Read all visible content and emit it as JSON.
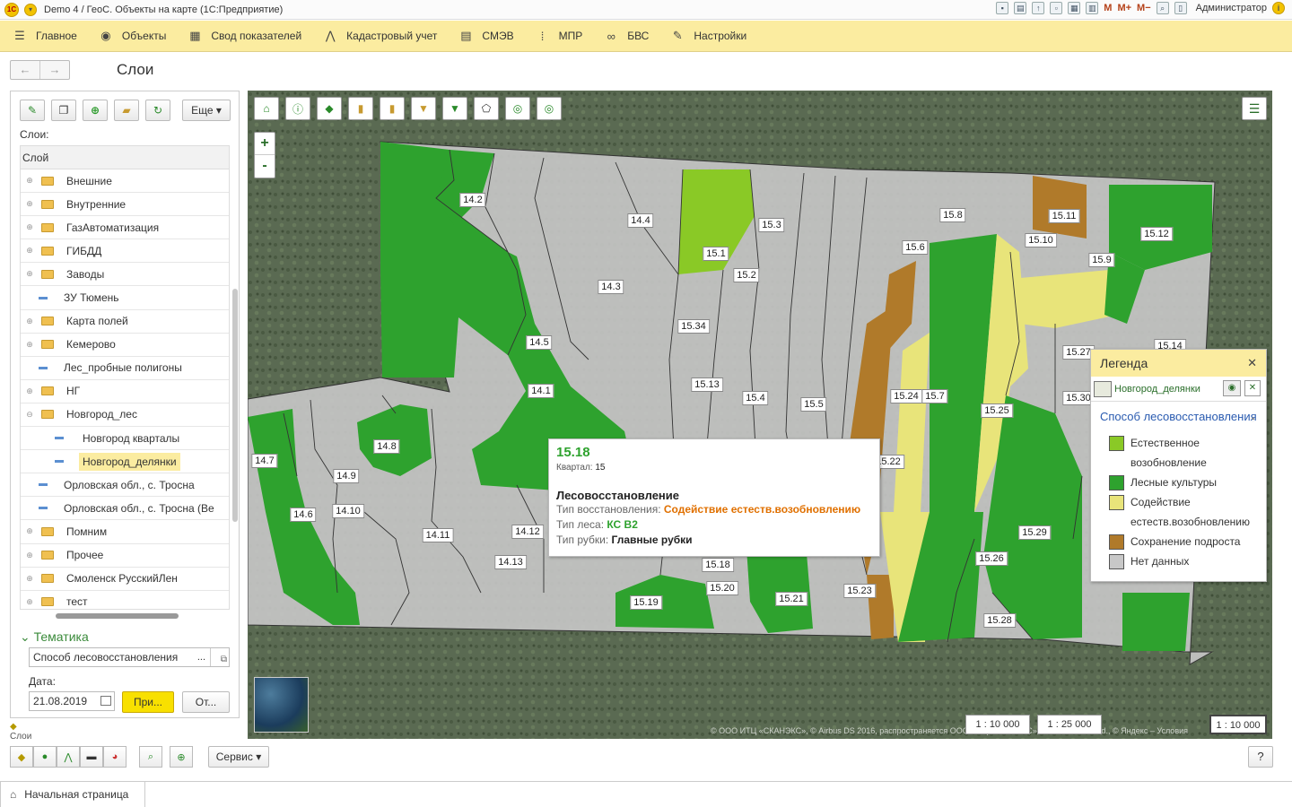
{
  "window": {
    "title": "Demo 4 / ГеоС. Объекты на карте",
    "app": "(1С:Предприятие)",
    "user": "Администратор"
  },
  "sections": [
    {
      "label": "Главное",
      "icon": "hamburger-icon"
    },
    {
      "label": "Объекты",
      "icon": "globe-icon"
    },
    {
      "label": "Свод показателей",
      "icon": "table-icon"
    },
    {
      "label": "Кадастровый учет",
      "icon": "compass-icon"
    },
    {
      "label": "СМЭВ",
      "icon": "document-icon"
    },
    {
      "label": "МПР",
      "icon": "blocks-icon"
    },
    {
      "label": "БВС",
      "icon": "link-icon"
    },
    {
      "label": "Настройки",
      "icon": "wrench-icon"
    }
  ],
  "page": {
    "title": "Слои"
  },
  "left": {
    "more_label": "Еще",
    "layers_label": "Слои:",
    "tree_header": "Слой",
    "tree": [
      {
        "label": "Внешние",
        "type": "folder"
      },
      {
        "label": "Внутренние",
        "type": "folder"
      },
      {
        "label": "ГазАвтоматизация",
        "type": "folder"
      },
      {
        "label": "ГИБДД",
        "type": "folder"
      },
      {
        "label": "Заводы",
        "type": "folder"
      },
      {
        "label": "ЗУ Тюмень",
        "type": "layer"
      },
      {
        "label": "Карта полей",
        "type": "folder"
      },
      {
        "label": "Кемерово",
        "type": "folder"
      },
      {
        "label": "Лес_пробные полигоны",
        "type": "layer"
      },
      {
        "label": "НГ",
        "type": "folder"
      },
      {
        "label": "Новгород_лес",
        "type": "folder-open"
      },
      {
        "label": "Новгород кварталы",
        "type": "child"
      },
      {
        "label": "Новгород_делянки",
        "type": "child-selected"
      },
      {
        "label": "Орловская обл., с. Тросна",
        "type": "layer"
      },
      {
        "label": "Орловская обл., с. Тросна (Ве",
        "type": "layer"
      },
      {
        "label": "Помним",
        "type": "folder"
      },
      {
        "label": "Прочее",
        "type": "folder"
      },
      {
        "label": "Смоленск РусскийЛен",
        "type": "folder"
      },
      {
        "label": "тест",
        "type": "folder"
      }
    ],
    "theme_header": "Тематика",
    "theme_value": "Способ лесовосстановления",
    "date_label": "Дата:",
    "date_value": "21.08.2019",
    "apply_label": "При...",
    "cancel_label": "От...",
    "bottom_label": "Слои"
  },
  "map": {
    "plots": [
      {
        "id": "14.2"
      },
      {
        "id": "14.4"
      },
      {
        "id": "15.1"
      },
      {
        "id": "15.3"
      },
      {
        "id": "15.2"
      },
      {
        "id": "14.3"
      },
      {
        "id": "15.34"
      },
      {
        "id": "14.5"
      },
      {
        "id": "15.13"
      },
      {
        "id": "14.1"
      },
      {
        "id": "15.4"
      },
      {
        "id": "15.5"
      },
      {
        "id": "15.8"
      },
      {
        "id": "15.6"
      },
      {
        "id": "15.11"
      },
      {
        "id": "15.10"
      },
      {
        "id": "15.12"
      },
      {
        "id": "15.9"
      },
      {
        "id": "15.27"
      },
      {
        "id": "15.14"
      },
      {
        "id": "15.24"
      },
      {
        "id": "15.7"
      },
      {
        "id": "15.25"
      },
      {
        "id": "15.30"
      },
      {
        "id": "15.22"
      },
      {
        "id": "14.8"
      },
      {
        "id": "14.7"
      },
      {
        "id": "14.9"
      },
      {
        "id": "14.6"
      },
      {
        "id": "14.10"
      },
      {
        "id": "14.11"
      },
      {
        "id": "14.12"
      },
      {
        "id": "14.13"
      },
      {
        "id": "15.18"
      },
      {
        "id": "15.20"
      },
      {
        "id": "15.19"
      },
      {
        "id": "15.21"
      },
      {
        "id": "15.23"
      },
      {
        "id": "15.29"
      },
      {
        "id": "15.26"
      },
      {
        "id": "15.28"
      }
    ],
    "popup": {
      "title": "15.18",
      "quarter_label": "Квартал:",
      "quarter_value": "15",
      "section": "Лесовосстановление",
      "rows": [
        {
          "label": "Тип восстановления:",
          "value": "Содействие естеств.возобновлению"
        },
        {
          "label": "Тип леса:",
          "value": "КС В2"
        },
        {
          "label": "Тип рубки:",
          "value": "Главные рубки"
        }
      ]
    },
    "legend": {
      "title": "Легенда",
      "layer": "Новгород_делянки",
      "method": "Способ лесовосстановления",
      "items": [
        {
          "label": "Естественное возобновление",
          "color": "#8ac926"
        },
        {
          "label": "Лесные культуры",
          "color": "#2ea22e"
        },
        {
          "label": "Содействие естеств.возобновлению",
          "color": "#e8e47a"
        },
        {
          "label": "Сохранение подроста",
          "color": "#b07a2a"
        },
        {
          "label": "Нет данных",
          "color": "#c8c8c8"
        }
      ]
    },
    "scales": [
      "1 : 10 000",
      "1 : 25 000",
      "1 : 10 000"
    ],
    "copyright": "© ООО ИТЦ «СКАНЭКС», © Airbus DS 2016, распространяется ООО ИТЦ «СКАНЭКС», © Planet Labs Ltd., © Яндекс – Условия"
  },
  "bottom": {
    "service_label": "Сервис",
    "help_label": "?",
    "home_tab": "Начальная страница"
  },
  "colors": {
    "natural": "#8ac926",
    "cultures": "#2ea22e",
    "assist": "#e8e47a",
    "undergrowth": "#b07a2a",
    "nodata": "#c8c8c8",
    "accent_yellow": "#fbeca0"
  }
}
